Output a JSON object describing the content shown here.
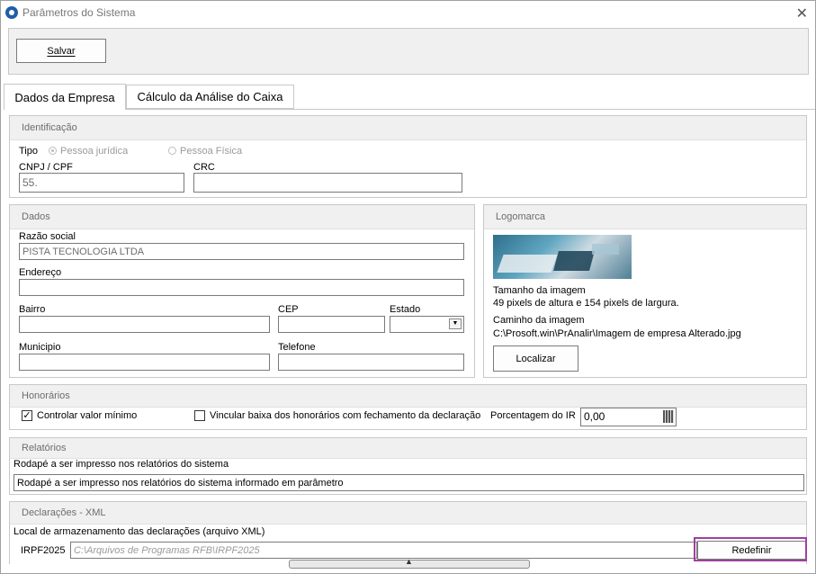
{
  "window": {
    "title": "Parâmetros do Sistema",
    "close_icon": "close-icon"
  },
  "toolbar": {
    "save_label": "Salvar"
  },
  "tabs": [
    {
      "label": "Dados da Empresa",
      "selected": true
    },
    {
      "label": "Cálculo da Análise do Caixa",
      "selected": false
    }
  ],
  "identificacao": {
    "title": "Identificação",
    "tipo_label": "Tipo",
    "radio_juridica": "Pessoa jurídica",
    "radio_fisica": "Pessoa Física",
    "cnpj_label": "CNPJ / CPF",
    "cnpj_value": "55.",
    "crc_label": "CRC",
    "crc_value": ""
  },
  "dados": {
    "title": "Dados",
    "razao_label": "Razão social",
    "razao_value": "PISTA TECNOLOGIA LTDA",
    "endereco_label": "Endereço",
    "endereco_value": "",
    "bairro_label": "Bairro",
    "bairro_value": "",
    "cep_label": "CEP",
    "cep_value": "",
    "estado_label": "Estado",
    "estado_value": "",
    "municipio_label": "Municipio",
    "municipio_value": "",
    "telefone_label": "Telefone",
    "telefone_value": ""
  },
  "logomarca": {
    "title": "Logomarca",
    "tamanho_label": "Tamanho da imagem",
    "tamanho_value": "49 pixels de altura e 154 pixels de largura.",
    "caminho_label": "Caminho da imagem",
    "caminho_value": "C:\\Prosoft.win\\PrAnalir\\Imagem de empresa Alterado.jpg",
    "localizar_label": "Localizar"
  },
  "honorarios": {
    "title": "Honorários",
    "controlar_label": "Controlar valor mínimo",
    "controlar_checked": true,
    "vincular_label": "Vincular baixa dos honorários com fechamento da declaração",
    "vincular_checked": false,
    "porcentagem_label": "Porcentagem do IR",
    "porcentagem_value": "0,00"
  },
  "relatorios": {
    "title": "Relatórios",
    "rodape_label": "Rodapé a ser impresso nos relatórios do sistema",
    "rodape_value": "Rodapé a ser impresso nos relatórios do sistema informado em parâmetro"
  },
  "declaracoes": {
    "title": "Declarações - XML",
    "local_label": "Local de armazenamento das declarações (arquivo XML)",
    "irpf_label": "IRPF2025",
    "irpf_value": "C:\\Arquivos de Programas RFB\\IRPF2025",
    "redefinir_label": "Redefinir"
  }
}
